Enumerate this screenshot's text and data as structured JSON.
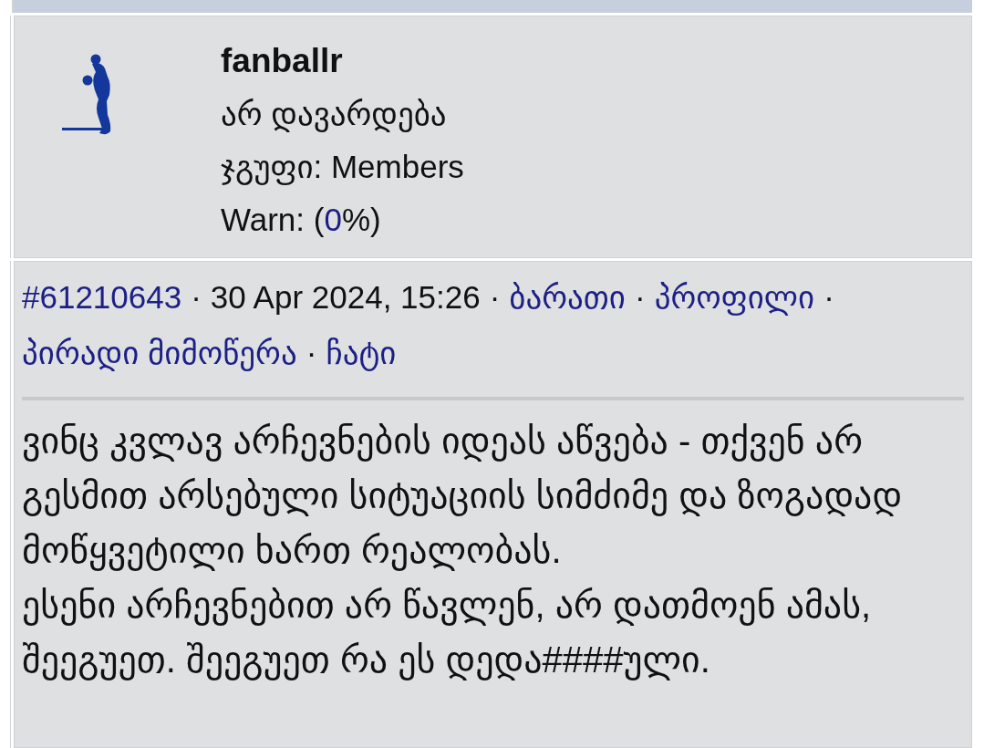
{
  "user": {
    "name": "fanballr",
    "title": "არ დავარდება",
    "group": "ჯგუფი: Members",
    "warn": {
      "prefix": "Warn: (",
      "value": "0",
      "suffix": "%)"
    }
  },
  "post": {
    "meta": [
      {
        "kind": "link",
        "text": "#61210643"
      },
      {
        "kind": "separator",
        "text": "·"
      },
      {
        "kind": "text",
        "text": "30 Apr 2024, 15:26"
      },
      {
        "kind": "separator",
        "text": "·"
      },
      {
        "kind": "link",
        "text": "ბარათი"
      },
      {
        "kind": "separator",
        "text": "·"
      },
      {
        "kind": "link",
        "text": "პროფილი"
      },
      {
        "kind": "separator",
        "text": "·"
      },
      {
        "kind": "link",
        "text": "პირადი მიმოწერა"
      },
      {
        "kind": "separator",
        "text": "·"
      },
      {
        "kind": "link",
        "text": "ჩატი"
      }
    ],
    "body": [
      "ვინც კვლავ არჩევნების იდეას აწვება - თქვენ არ გესმით არსებული სიტუაციის სიმძიმე და ზოგადად მოწყვეტილი ხართ რეალობას.",
      "ესენი არჩევნებით არ წავლენ, არ დათმოენ ამას, შეეგუეთ. შეეგუეთ რა ეს დედა####ული."
    ]
  }
}
